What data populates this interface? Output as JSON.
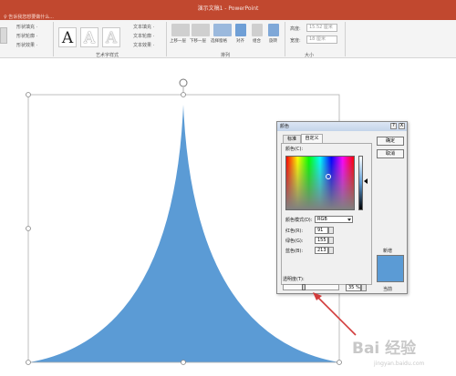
{
  "title_bar": {
    "title": "演示文稿1 - PowerPoint",
    "tell_me": "♀ 告诉我您想要做什么..."
  },
  "ribbon": {
    "shape_fill": "形状填充 ·",
    "shape_outline": "形状轮廓 ·",
    "shape_effect": "形状效果 ·",
    "wordart_letters": [
      "A",
      "A",
      "A"
    ],
    "text_fill": "文本填充 ·",
    "text_outline": "文本轮廓 ·",
    "text_effect": "文本效果 ·",
    "wordart_group": "艺术字样式",
    "bring_forward": "上移一层",
    "send_backward": "下移一层",
    "selection_pane": "选择窗格",
    "align": "对齐",
    "group": "组合",
    "rotate": "旋转",
    "arrange_group": "排列",
    "height_label": "高度:",
    "height_value": "15.52 厘米",
    "width_label": "宽度:",
    "width_value": "18 厘米",
    "size_group": "大小"
  },
  "dialog": {
    "title": "颜色",
    "help": "?",
    "close": "X",
    "tab_standard": "标准",
    "tab_custom": "自定义",
    "ok": "确定",
    "cancel": "取消",
    "colors_label": "颜色(C):",
    "color_model_label": "颜色模式(D):",
    "color_model_value": "RGB",
    "red_label": "红色(R):",
    "red_value": "91",
    "green_label": "绿色(G):",
    "green_value": "155",
    "blue_label": "蓝色(B):",
    "blue_value": "213",
    "transparency_label": "透明度(T):",
    "transparency_value": "35 %",
    "transparency_fraction": 0.35,
    "new_label": "新增",
    "current_label": "当前",
    "new_color": "#5b9bd5"
  },
  "shape_color": "#5b9bd5",
  "arrow_color": "#d23b3b",
  "watermark": {
    "text": "Bai 经验",
    "sub": "jingyan.baidu.com"
  }
}
